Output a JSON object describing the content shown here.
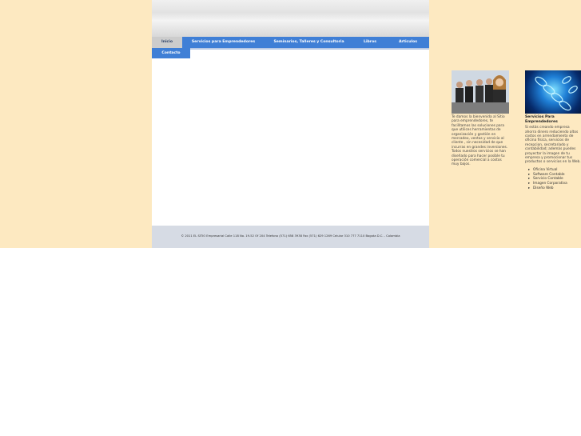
{
  "nav": {
    "items": [
      {
        "label": "Inicio"
      },
      {
        "label": "Servicios para Emprendedores"
      },
      {
        "label": "Seminarios, Talleres y Consultoria"
      },
      {
        "label": "Libros"
      },
      {
        "label": "Articulos"
      }
    ],
    "contact": "Contacto"
  },
  "footer": {
    "text": "© 2011 EL SITIO Empresarial Calle 118 No. 19-52 Of 204 Telefono (571) 658 3938 Fax (571) 629 1269 Celular 310 777 7110 Bogota D.C. - Colombia"
  },
  "sidebar1": {
    "text": "Te damos la bienvenida al Sitio para emprendedores, te facilitamos las soluciones para que utilices herramientas de organización y gestión en mercadeo, ventas y servicio al cliente , sin necesidad de que incurras en grandes inversiones. Todos nuestros servicios se han diseñado para hacer posible tu operación comercial a costos muy bajos."
  },
  "sidebar2": {
    "heading": "Servicios Para Emprendedores",
    "text": "Si estás creando empresa ahorra dinero reduciendo altos costos en arrendamiento de oficina física, servicios de recepcion, secretariado y contabilidad; además puedes proyectar la imagen de tu empresa y promocionar tus productos o servicios en la Web.",
    "links": [
      "Oficina Virtual",
      "Software Contable",
      "Servicio Contable",
      "Imagen Corporativa",
      "Diseño Web"
    ]
  }
}
